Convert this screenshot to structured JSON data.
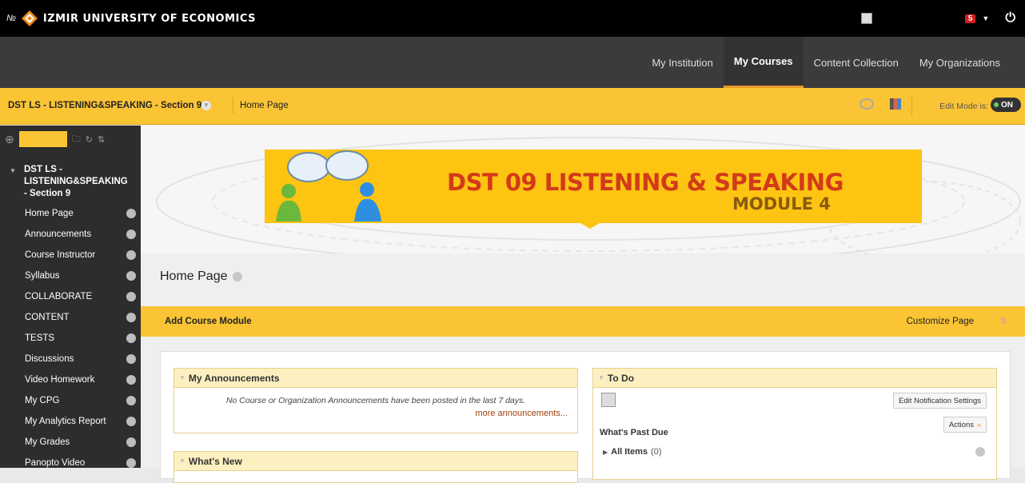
{
  "topbar": {
    "university": "IZMIR UNIVERSITY OF ECONOMICS",
    "notification_count": "5"
  },
  "nav": {
    "tabs": [
      {
        "label": "My Institution"
      },
      {
        "label": "My Courses",
        "active": true
      },
      {
        "label": "Content Collection"
      },
      {
        "label": "My Organizations"
      }
    ]
  },
  "coursebar": {
    "course_name": "DST LS - LISTENING&SPEAKING - Section 9",
    "breadcrumb": "Home Page",
    "edit_mode_label": "Edit Mode is:",
    "edit_mode_value": "ON"
  },
  "sidebar": {
    "course_title": "DST LS - LISTENING&SPEAKING - Section 9",
    "items": [
      {
        "label": "Home Page"
      },
      {
        "label": "Announcements"
      },
      {
        "label": "Course Instructor"
      },
      {
        "label": "Syllabus"
      },
      {
        "label": "COLLABORATE"
      },
      {
        "label": "CONTENT"
      },
      {
        "label": "TESTS"
      },
      {
        "label": "Discussions"
      },
      {
        "label": "Video Homework"
      },
      {
        "label": "My CPG"
      },
      {
        "label": "My Analytics Report"
      },
      {
        "label": "My Grades"
      },
      {
        "label": "Panopto Video"
      }
    ]
  },
  "banner": {
    "title": "DST 09 LISTENING & SPEAKING",
    "subtitle": "MODULE 4"
  },
  "main": {
    "page_title": "Home Page",
    "add_module": "Add Course Module",
    "customize": "Customize Page"
  },
  "modules": {
    "announcements": {
      "title": "My Announcements",
      "message": "No Course or Organization Announcements have been posted in the last 7 days.",
      "more": "more announcements..."
    },
    "whats_new": {
      "title": "What's New"
    },
    "todo": {
      "title": "To Do",
      "notif_button": "Edit Notification Settings",
      "actions": "Actions",
      "past_due": "What's Past Due",
      "all_items": "All Items",
      "all_items_count": "(0)"
    }
  },
  "colors": {
    "accent": "#fbc434",
    "nav_bg": "#3b3b3b",
    "sidebar_bg": "#2d2d2d",
    "banner_title": "#d33a1a"
  }
}
